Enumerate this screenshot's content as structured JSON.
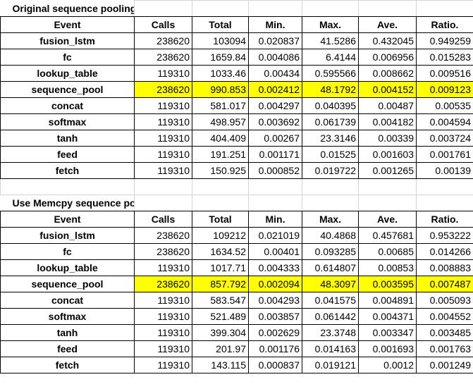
{
  "colors": {
    "highlight": "#ffff00",
    "grid": "#000000",
    "gridlines": "#d4d4d4"
  },
  "tables": [
    {
      "title": "Original sequence pooling",
      "headers": [
        "Event",
        "Calls",
        "Total",
        "Min.",
        "Max.",
        "Ave.",
        "Ratio."
      ],
      "rows": [
        [
          "fusion_lstm",
          "238620",
          "103094",
          "0.020837",
          "41.5286",
          "0.432045",
          "0.949259"
        ],
        [
          "fc",
          "238620",
          "1659.84",
          "0.004086",
          "6.4144",
          "0.006956",
          "0.015283"
        ],
        [
          "lookup_table",
          "119310",
          "1033.46",
          "0.00434",
          "0.595566",
          "0.008662",
          "0.009516"
        ],
        [
          "sequence_pool",
          "238620",
          "990.853",
          "0.002412",
          "48.1792",
          "0.004152",
          "0.009123"
        ],
        [
          "concat",
          "119310",
          "581.017",
          "0.004297",
          "0.040395",
          "0.00487",
          "0.00535"
        ],
        [
          "softmax",
          "119310",
          "498.957",
          "0.003692",
          "0.061739",
          "0.004182",
          "0.004594"
        ],
        [
          "tanh",
          "119310",
          "404.409",
          "0.00267",
          "23.3146",
          "0.00339",
          "0.003724"
        ],
        [
          "feed",
          "119310",
          "191.251",
          "0.001171",
          "0.01525",
          "0.001603",
          "0.001761"
        ],
        [
          "fetch",
          "119310",
          "150.925",
          "0.000852",
          "0.019722",
          "0.001265",
          "0.00139"
        ]
      ],
      "highlighted_row": 3
    },
    {
      "title": "Use Memcpy sequence pooling",
      "headers": [
        "Event",
        "Calls",
        "Total",
        "Min.",
        "Max.",
        "Ave.",
        "Ratio."
      ],
      "rows": [
        [
          "fusion_lstm",
          "238620",
          "109212",
          "0.021019",
          "40.4868",
          "0.457681",
          "0.953222"
        ],
        [
          "fc",
          "238620",
          "1634.52",
          "0.00401",
          "0.093285",
          "0.00685",
          "0.014266"
        ],
        [
          "lookup_table",
          "119310",
          "1017.71",
          "0.004333",
          "0.614807",
          "0.00853",
          "0.008883"
        ],
        [
          "sequence_pool",
          "238620",
          "857.792",
          "0.002094",
          "48.3097",
          "0.003595",
          "0.007487"
        ],
        [
          "concat",
          "119310",
          "583.547",
          "0.004293",
          "0.041575",
          "0.004891",
          "0.005093"
        ],
        [
          "softmax",
          "119310",
          "521.489",
          "0.003857",
          "0.061442",
          "0.004371",
          "0.004552"
        ],
        [
          "tanh",
          "119310",
          "399.304",
          "0.002629",
          "23.3748",
          "0.003347",
          "0.003485"
        ],
        [
          "feed",
          "119310",
          "201.97",
          "0.001176",
          "0.014163",
          "0.001693",
          "0.001763"
        ],
        [
          "fetch",
          "119310",
          "143.115",
          "0.000837",
          "0.019121",
          "0.0012",
          "0.001249"
        ]
      ],
      "highlighted_row": 3
    }
  ]
}
